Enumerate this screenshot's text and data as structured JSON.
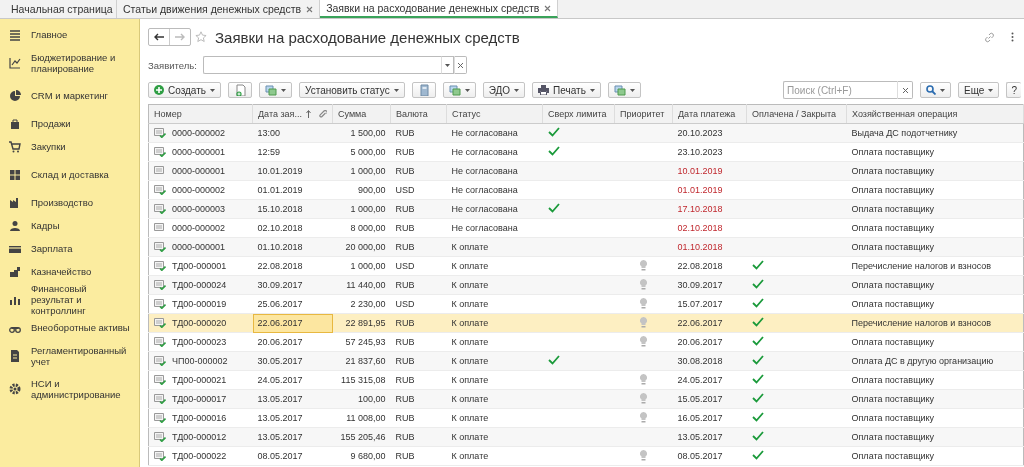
{
  "tabs": [
    {
      "label": "Начальная страница",
      "kind": "home",
      "selected": false
    },
    {
      "label": "Статьи движения денежных средств",
      "kind": "doc",
      "selected": false
    },
    {
      "label": "Заявки на расходование денежных средств",
      "kind": "doc",
      "selected": true
    }
  ],
  "sidebar": {
    "items": [
      {
        "label": "Главное"
      },
      {
        "label": "Бюджетирование и планирование"
      },
      {
        "label": "CRM и маркетинг"
      },
      {
        "label": "Продажи"
      },
      {
        "label": "Закупки"
      },
      {
        "label": "Склад и доставка"
      },
      {
        "label": "Производство"
      },
      {
        "label": "Кадры"
      },
      {
        "label": "Зарплата"
      },
      {
        "label": "Казначейство"
      },
      {
        "label": "Финансовый результат и контроллинг"
      },
      {
        "label": "Внеоборотные активы"
      },
      {
        "label": "Регламентированный учет"
      },
      {
        "label": "НСИ и администрирование"
      }
    ]
  },
  "form": {
    "title": "Заявки на расходование денежных средств",
    "filter_label": "Заявитель:",
    "toolbar": [
      {
        "kind": "create",
        "label": "Создать"
      },
      {
        "kind": "icon-copy"
      },
      {
        "kind": "icon-menu"
      },
      {
        "kind": "text",
        "label": "Установить статус"
      },
      {
        "kind": "icon-calc"
      },
      {
        "kind": "icon-menu"
      },
      {
        "kind": "text",
        "label": "ЭДО"
      },
      {
        "kind": "print",
        "label": "Печать"
      },
      {
        "kind": "icon-menu"
      }
    ],
    "search": {
      "placeholder": "Поиск (Ctrl+F)"
    },
    "more_label": "Еще",
    "help_label": "?"
  },
  "table": {
    "columns": [
      "Номер",
      "Дата зая...",
      "Сумма",
      "Валюта",
      "Статус",
      "Сверх лимита",
      "Приоритет",
      "Дата платежа",
      "Оплачена / Закрыта",
      "Хозяйственная операция"
    ],
    "rows": [
      {
        "number": "0000-000002",
        "date": "13:00",
        "sum": "1 500,00",
        "currency": "RUB",
        "status": "Не согласована",
        "over_limit": true,
        "low_priority": false,
        "pay_date": "20.10.2023",
        "overdue": false,
        "paid": false,
        "operation": "Выдача ДС подотчетнику",
        "posted": true,
        "selected": false
      },
      {
        "number": "0000-000001",
        "date": "12:59",
        "sum": "5 000,00",
        "currency": "RUB",
        "status": "Не согласована",
        "over_limit": true,
        "low_priority": false,
        "pay_date": "23.10.2023",
        "overdue": false,
        "paid": false,
        "operation": "Оплата поставщику",
        "posted": true,
        "selected": false
      },
      {
        "number": "0000-000001",
        "date": "10.01.2019",
        "sum": "1 000,00",
        "currency": "RUB",
        "status": "Не согласована",
        "over_limit": false,
        "low_priority": false,
        "pay_date": "10.01.2019",
        "overdue": true,
        "paid": false,
        "operation": "Оплата поставщику",
        "posted": false,
        "selected": false
      },
      {
        "number": "0000-000002",
        "date": "01.01.2019",
        "sum": "900,00",
        "currency": "USD",
        "status": "Не согласована",
        "over_limit": false,
        "low_priority": false,
        "pay_date": "01.01.2019",
        "overdue": true,
        "paid": false,
        "operation": "Оплата поставщику",
        "posted": true,
        "selected": false
      },
      {
        "number": "0000-000003",
        "date": "15.10.2018",
        "sum": "1 000,00",
        "currency": "RUB",
        "status": "Не согласована",
        "over_limit": true,
        "low_priority": false,
        "pay_date": "17.10.2018",
        "overdue": true,
        "paid": false,
        "operation": "Оплата поставщику",
        "posted": true,
        "selected": false
      },
      {
        "number": "0000-000002",
        "date": "02.10.2018",
        "sum": "8 000,00",
        "currency": "RUB",
        "status": "Не согласована",
        "over_limit": false,
        "low_priority": false,
        "pay_date": "02.10.2018",
        "overdue": true,
        "paid": false,
        "operation": "Оплата поставщику",
        "posted": false,
        "selected": false
      },
      {
        "number": "0000-000001",
        "date": "01.10.2018",
        "sum": "20 000,00",
        "currency": "RUB",
        "status": "К оплате",
        "over_limit": false,
        "low_priority": false,
        "pay_date": "01.10.2018",
        "overdue": true,
        "paid": false,
        "operation": "Оплата поставщику",
        "posted": true,
        "selected": false
      },
      {
        "number": "ТД00-000001",
        "date": "22.08.2018",
        "sum": "1 000,00",
        "currency": "USD",
        "status": "К оплате",
        "over_limit": false,
        "low_priority": true,
        "pay_date": "22.08.2018",
        "overdue": false,
        "paid": true,
        "operation": "Перечисление налогов и взносов",
        "posted": true,
        "selected": false
      },
      {
        "number": "ТД00-000024",
        "date": "30.09.2017",
        "sum": "11 440,00",
        "currency": "RUB",
        "status": "К оплате",
        "over_limit": false,
        "low_priority": true,
        "pay_date": "30.09.2017",
        "overdue": false,
        "paid": true,
        "operation": "Оплата поставщику",
        "posted": true,
        "selected": false
      },
      {
        "number": "ТД00-000019",
        "date": "25.06.2017",
        "sum": "2 230,00",
        "currency": "USD",
        "status": "К оплате",
        "over_limit": false,
        "low_priority": true,
        "pay_date": "15.07.2017",
        "overdue": false,
        "paid": true,
        "operation": "Оплата поставщику",
        "posted": true,
        "selected": false
      },
      {
        "number": "ТД00-000020",
        "date": "22.06.2017",
        "sum": "22 891,95",
        "currency": "RUB",
        "status": "К оплате",
        "over_limit": false,
        "low_priority": true,
        "pay_date": "22.06.2017",
        "overdue": false,
        "paid": true,
        "operation": "Перечисление налогов и взносов",
        "posted": true,
        "selected": true
      },
      {
        "number": "ТД00-000023",
        "date": "20.06.2017",
        "sum": "57 245,93",
        "currency": "RUB",
        "status": "К оплате",
        "over_limit": false,
        "low_priority": true,
        "pay_date": "20.06.2017",
        "overdue": false,
        "paid": true,
        "operation": "Оплата поставщику",
        "posted": true,
        "selected": false
      },
      {
        "number": "ЧП00-000002",
        "date": "30.05.2017",
        "sum": "21 837,60",
        "currency": "RUB",
        "status": "К оплате",
        "over_limit": true,
        "low_priority": false,
        "pay_date": "30.08.2018",
        "overdue": false,
        "paid": true,
        "operation": "Оплата ДС в другую организацию",
        "posted": true,
        "selected": false
      },
      {
        "number": "ТД00-000021",
        "date": "24.05.2017",
        "sum": "115 315,08",
        "currency": "RUB",
        "status": "К оплате",
        "over_limit": false,
        "low_priority": true,
        "pay_date": "24.05.2017",
        "overdue": false,
        "paid": true,
        "operation": "Оплата поставщику",
        "posted": true,
        "selected": false
      },
      {
        "number": "ТД00-000017",
        "date": "13.05.2017",
        "sum": "100,00",
        "currency": "RUB",
        "status": "К оплате",
        "over_limit": false,
        "low_priority": true,
        "pay_date": "15.05.2017",
        "overdue": false,
        "paid": true,
        "operation": "Оплата поставщику",
        "posted": true,
        "selected": false
      },
      {
        "number": "ТД00-000016",
        "date": "13.05.2017",
        "sum": "11 008,00",
        "currency": "RUB",
        "status": "К оплате",
        "over_limit": false,
        "low_priority": true,
        "pay_date": "16.05.2017",
        "overdue": false,
        "paid": true,
        "operation": "Оплата поставщику",
        "posted": true,
        "selected": false
      },
      {
        "number": "ТД00-000012",
        "date": "13.05.2017",
        "sum": "155 205,46",
        "currency": "RUB",
        "status": "К оплате",
        "over_limit": false,
        "low_priority": false,
        "pay_date": "13.05.2017",
        "overdue": false,
        "paid": true,
        "operation": "Оплата поставщику",
        "posted": true,
        "selected": false
      },
      {
        "number": "ТД00-000022",
        "date": "08.05.2017",
        "sum": "9 680,00",
        "currency": "RUB",
        "status": "К оплате",
        "over_limit": false,
        "low_priority": true,
        "pay_date": "08.05.2017",
        "overdue": false,
        "paid": true,
        "operation": "Оплата поставщику",
        "posted": true,
        "selected": false
      }
    ]
  }
}
